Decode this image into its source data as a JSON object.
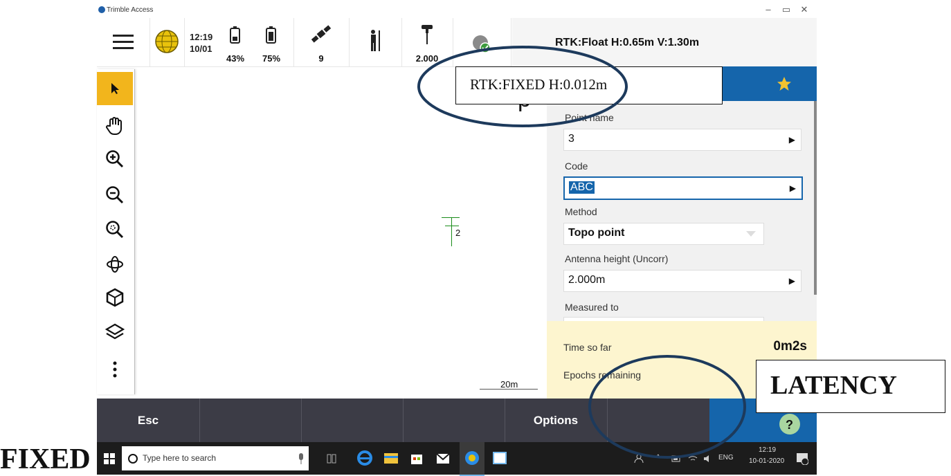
{
  "window": {
    "title": "Trimble Access",
    "controls": {
      "minimize": "–",
      "restore": "▭",
      "close": "✕"
    }
  },
  "statusbar": {
    "time": "12:19",
    "date": "10/01",
    "battery1": "43%",
    "battery2": "75%",
    "satellites": "9",
    "antenna_height": "2.000",
    "rtk_status": "RTK:Float H:0.65m V:1.30m"
  },
  "map": {
    "point_label": "2",
    "scale_label": "20m",
    "partial_title": "p"
  },
  "panel": {
    "fields": [
      {
        "label": "Point name",
        "value": "3"
      },
      {
        "label": "Code",
        "value": "ABC"
      },
      {
        "label": "Method",
        "value": "Topo point"
      },
      {
        "label": "Antenna height (Uncorr)",
        "value": "2.000m"
      },
      {
        "label": "Measured to",
        "value": ""
      }
    ],
    "time_so_far_label": "Time so far",
    "time_so_far_value": "0m2s",
    "epochs_label": "Epochs remaining"
  },
  "actionbar": {
    "esc": "Esc",
    "options": "Options"
  },
  "taskbar": {
    "search_placeholder": "Type here to search",
    "lang": "ENG",
    "time": "12:19",
    "date": "10-01-2020"
  },
  "annotations": {
    "rtk_fixed": "RTK:FIXED H:0.012m",
    "latency": "LATENCY",
    "fixed": "FIXED"
  },
  "colors": {
    "accent_blue": "#1565ab",
    "toolbar_active": "#f2b51c",
    "star": "#f2c230",
    "ellipse": "#1d3a5c"
  }
}
